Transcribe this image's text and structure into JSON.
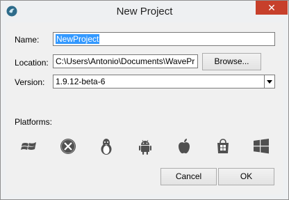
{
  "window": {
    "title": "New Project",
    "close_glyph": "✕"
  },
  "form": {
    "name_label": "Name:",
    "name_value": "NewProject",
    "location_label": "Location:",
    "location_value": "C:\\Users\\Antonio\\Documents\\WavePr",
    "browse_label": "Browse...",
    "version_label": "Version:",
    "version_value": "1.9.12-beta-6"
  },
  "platforms": {
    "label": "Platforms:",
    "items": [
      "windows-xp-icon",
      "macos-x-icon",
      "linux-tux-icon",
      "android-icon",
      "apple-icon",
      "windows-store-icon",
      "windows-icon"
    ]
  },
  "buttons": {
    "cancel": "Cancel",
    "ok": "OK"
  },
  "colors": {
    "selection": "#3399ff",
    "close": "#c7402b",
    "icon": "#505050"
  }
}
